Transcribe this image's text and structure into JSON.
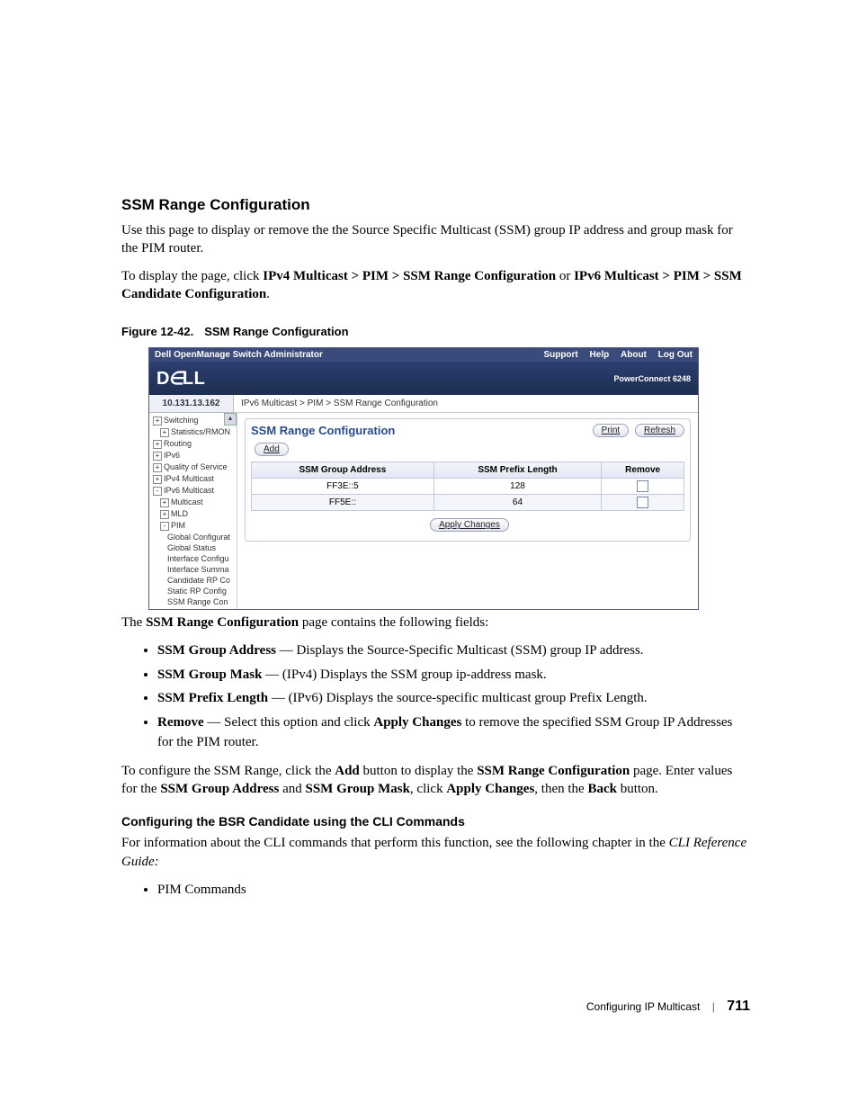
{
  "section": {
    "title": "SSM Range Configuration"
  },
  "para1": "Use this page to display or remove the the Source Specific Multicast (SSM) group IP address and group mask for the PIM router.",
  "para2_a": "To display the page, click ",
  "para2_b": "IPv4 Multicast > PIM > SSM Range Configuration",
  "para2_c": " or ",
  "para2_d": "IPv6 Multicast > PIM > SSM Candidate Configuration",
  "para2_e": ".",
  "figcap": {
    "num": "Figure 12-42.",
    "title": "SSM Range Configuration"
  },
  "app": {
    "topbar_title": "Dell OpenManage Switch Administrator",
    "menu": {
      "support": "Support",
      "help": "Help",
      "about": "About",
      "logout": "Log Out"
    },
    "logo": "DELL",
    "model": "PowerConnect 6248",
    "ip": "10.131.13.162",
    "crumb": "IPv6 Multicast > PIM > SSM Range Configuration",
    "tree": {
      "switching": "Switching",
      "stats": "Statistics/RMON",
      "routing": "Routing",
      "ipv6": "IPv6",
      "qos": "Quality of Service",
      "ipv4m": "IPv4 Multicast",
      "ipv6m": "IPv6 Multicast",
      "multicast": "Multicast",
      "mld": "MLD",
      "pim": "PIM",
      "gc": "Global Configurat",
      "gs": "Global Status",
      "ic": "Interface Configu",
      "is": "Interface Summa",
      "crp": "Candidate RP Co",
      "srp": "Static RP Config",
      "ssm": "SSM Range Con"
    },
    "panel": {
      "title": "SSM Range Configuration",
      "print": "Print",
      "refresh": "Refresh",
      "add": "Add",
      "apply": "Apply Changes",
      "th1": "SSM Group Address",
      "th2": "SSM Prefix Length",
      "th3": "Remove",
      "r1c1": "FF3E::5",
      "r1c2": "128",
      "r2c1": "FF5E::",
      "r2c2": "64"
    }
  },
  "after_fig": {
    "lead_a": "The ",
    "lead_b": "SSM Range Configuration",
    "lead_c": " page contains the following fields:"
  },
  "fields": {
    "f1_b": "SSM Group Address",
    "f1_t": " — Displays the Source-Specific Multicast (SSM) group IP address.",
    "f2_b": "SSM Group Mask",
    "f2_t": " — (IPv4) Displays the SSM group ip-address mask.",
    "f3_b": "SSM Prefix Length",
    "f3_t": " — (IPv6) Displays the source-specific multicast group Prefix Length.",
    "f4_b": "Remove",
    "f4_t1": " — Select this option and click ",
    "f4_t2": "Apply Changes",
    "f4_t3": " to remove the specified SSM Group IP Addresses for the PIM router."
  },
  "conf": {
    "a": "To configure the SSM Range, click the ",
    "b": "Add",
    "c": " button to display the ",
    "d": "SSM Range Configuration",
    "e": " page. Enter values for the ",
    "f": "SSM Group Address",
    "g": " and ",
    "h": "SSM Group Mask",
    "i": ", click ",
    "j": "Apply Changes",
    "k": ", then the ",
    "l": "Back",
    "m": " button."
  },
  "cli": {
    "heading": "Configuring the BSR Candidate using the CLI Commands",
    "line1": "For information about the CLI commands that perform this function, see the following chapter in the ",
    "guide": "CLI Reference Guide:",
    "item": "PIM Commands"
  },
  "footer": {
    "chapter": "Configuring IP Multicast",
    "page": "711"
  }
}
